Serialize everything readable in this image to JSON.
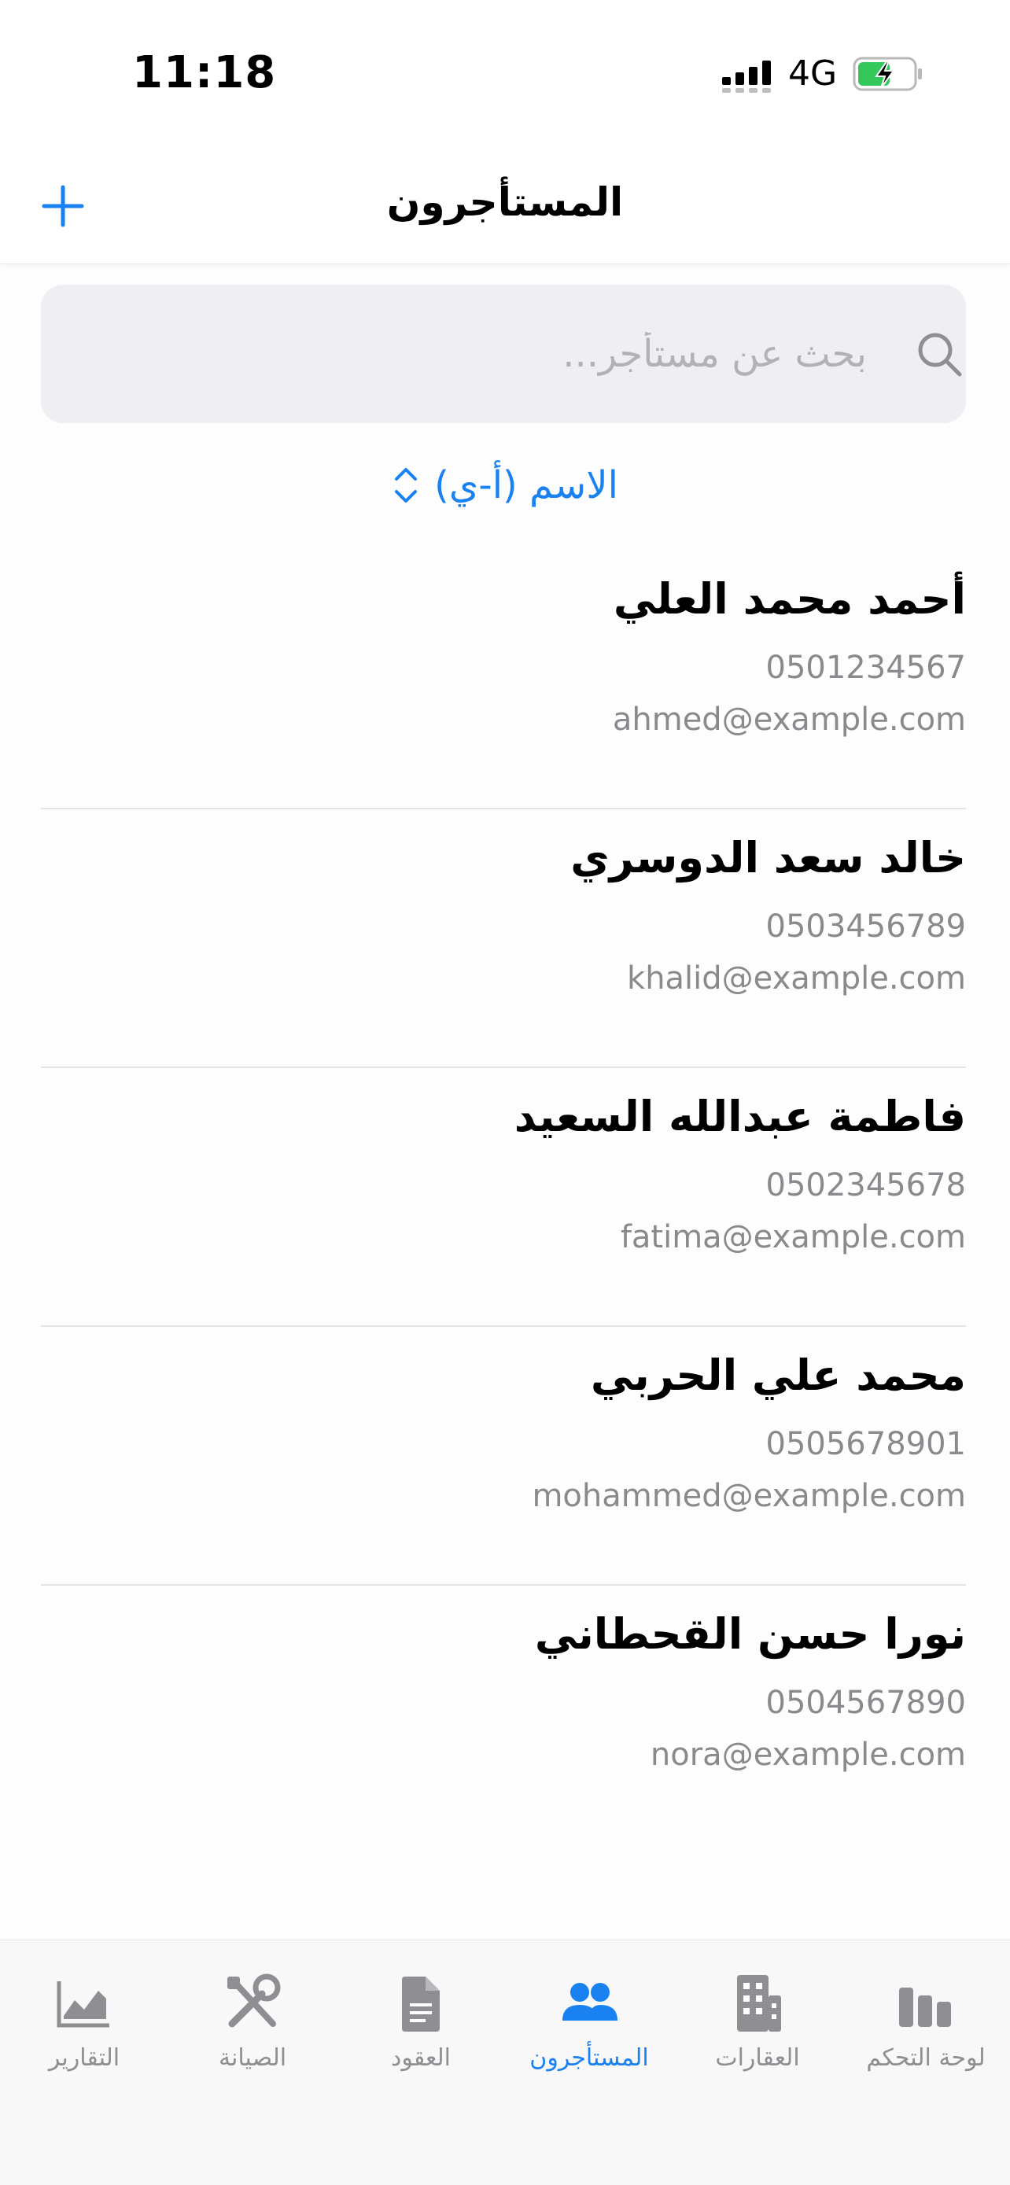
{
  "status_bar": {
    "time": "11:18",
    "network": "4G"
  },
  "header": {
    "title": "المستأجرون"
  },
  "search": {
    "placeholder": "بحث عن مستأجر..."
  },
  "sort": {
    "label": "الاسم (أ-ي)"
  },
  "tenants": [
    {
      "name": "أحمد محمد العلي",
      "phone": "0501234567",
      "email": "ahmed@example.com"
    },
    {
      "name": "خالد سعد الدوسري",
      "phone": "0503456789",
      "email": "khalid@example.com"
    },
    {
      "name": "فاطمة عبدالله السعيد",
      "phone": "0502345678",
      "email": "fatima@example.com"
    },
    {
      "name": "محمد علي الحربي",
      "phone": "0505678901",
      "email": "mohammed@example.com"
    },
    {
      "name": "نورا حسن القحطاني",
      "phone": "0504567890",
      "email": "nora@example.com"
    }
  ],
  "tabs": [
    {
      "label": "لوحة التحكم",
      "icon": "chart-bars-icon",
      "active": false
    },
    {
      "label": "العقارات",
      "icon": "building-icon",
      "active": false
    },
    {
      "label": "المستأجرون",
      "icon": "people-icon",
      "active": true
    },
    {
      "label": "العقود",
      "icon": "document-icon",
      "active": false
    },
    {
      "label": "الصيانة",
      "icon": "tools-icon",
      "active": false
    },
    {
      "label": "التقارير",
      "icon": "line-chart-icon",
      "active": false
    }
  ],
  "colors": {
    "accent": "#1a82f0",
    "battery": "#34c759",
    "secondary_text": "#8a8a8e"
  }
}
